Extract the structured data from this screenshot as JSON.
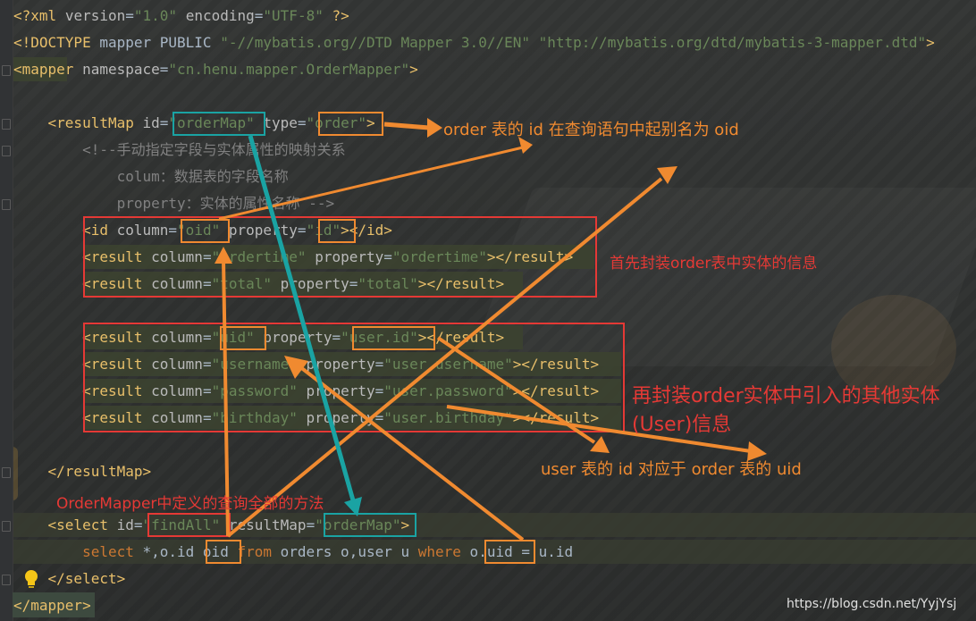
{
  "editor": {
    "lines": [
      {
        "text": "<?xml version=\"1.0\" encoding=\"UTF-8\" ?>"
      },
      {
        "text": "<!DOCTYPE mapper PUBLIC \"-//mybatis.org//DTD Mapper 3.0//EN\" \"http://mybatis.org/dtd/mybatis-3-mapper.dtd\">"
      },
      {
        "text": "<mapper namespace=\"cn.henu.mapper.OrderMapper\">"
      },
      {
        "text": ""
      },
      {
        "text": "    <resultMap id=\"orderMap\" type=\"order\">"
      },
      {
        "text": "        <!--手动指定字段与实体属性的映射关系"
      },
      {
        "text": "            colum：数据表的字段名称"
      },
      {
        "text": "            property：实体的属性名称 -->"
      },
      {
        "text": "        <id column=\"oid\" property=\"id\"></id>"
      },
      {
        "text": "        <result column=\"ordertime\" property=\"ordertime\"></result>"
      },
      {
        "text": "        <result column=\"total\" property=\"total\"></result>"
      },
      {
        "text": ""
      },
      {
        "text": "        <result column=\"uid\" property=\"user.id\"></result>"
      },
      {
        "text": "        <result column=\"username\" property=\"user.username\"></result>"
      },
      {
        "text": "        <result column=\"password\" property=\"user.password\"></result>"
      },
      {
        "text": "        <result column=\"birthday\" property=\"user.birthday\"></result>"
      },
      {
        "text": ""
      },
      {
        "text": "    </resultMap>"
      },
      {
        "text": ""
      },
      {
        "text": "    <select id=\"findAll\" resultMap=\"orderMap\">"
      },
      {
        "text": "        select *,o.id oid from orders o,user u where o.uid = u.id"
      },
      {
        "text": "    </select>"
      },
      {
        "text": "</mapper>"
      }
    ]
  },
  "annotations": {
    "order_oid": "order 表的 id 在查询语句中起别名为 oid",
    "order_info": "首先封装order表中实体的信息",
    "user_info_line1": "再封装order实体中引入的其他实体",
    "user_info_line2": "(User)信息",
    "user_uid": "user 表的 id 对应于 order 表的 uid",
    "findall_method": "OrderMapper中定义的查询全部的方法"
  },
  "watermark": "https://blog.csdn.net/YyjYsj",
  "colors": {
    "orange": "#f08a30",
    "red": "#e53935",
    "teal": "#1aa3a3"
  },
  "icons": {
    "intention": "lightbulb-icon"
  }
}
